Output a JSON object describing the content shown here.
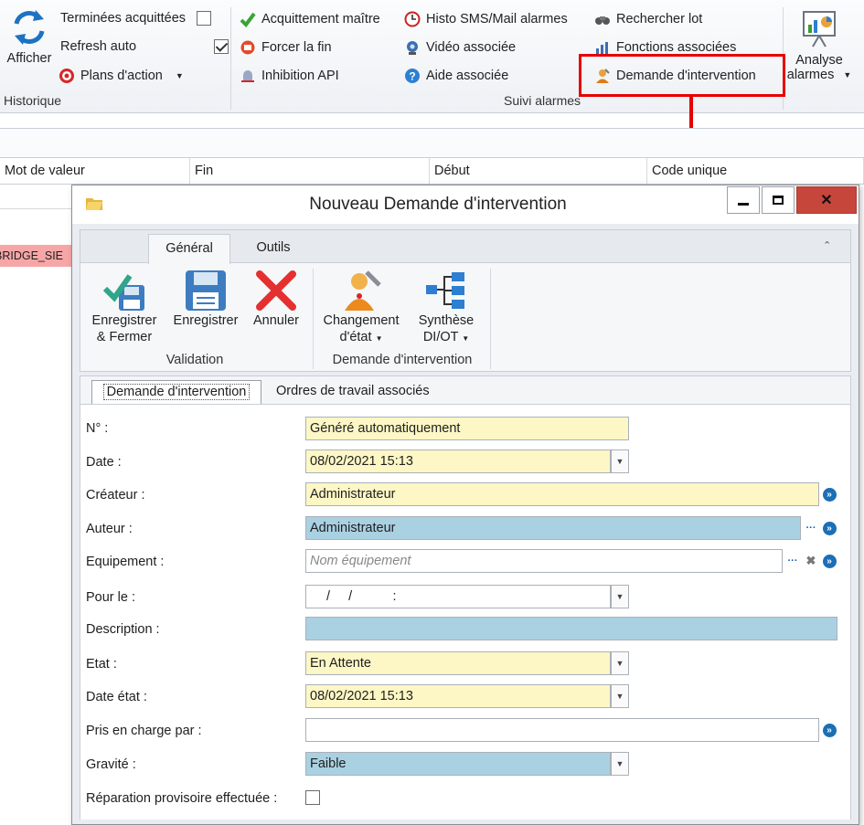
{
  "ribbon": {
    "afficher": "Afficher",
    "terminees": "Terminées acquittées",
    "refresh": "Refresh auto",
    "plans": "Plans d'action",
    "historique": "Historique",
    "acquittement": "Acquittement maître",
    "forcer": "Forcer la fin",
    "inhibition": "Inhibition API",
    "histo": "Histo SMS/Mail alarmes",
    "video": "Vidéo associée",
    "aide": "Aide associée",
    "rechercher": "Rechercher lot",
    "fonctions": "Fonctions associées",
    "demande": "Demande d'intervention",
    "suivi": "Suivi alarmes",
    "analyse": "Analyse",
    "alarmes": "alarmes"
  },
  "grid": {
    "columns": [
      "Mot de valeur",
      "Fin",
      "Début",
      "Code unique"
    ],
    "row_text": "BRIDGE_SIE"
  },
  "dialog": {
    "title": "Nouveau Demande d'intervention",
    "tabs": [
      "Général",
      "Outils"
    ],
    "buttons": {
      "save_close_1": "Enregistrer",
      "save_close_2": "& Fermer",
      "save": "Enregistrer",
      "cancel": "Annuler",
      "change_1": "Changement",
      "change_2": "d'état",
      "synth_1": "Synthèse",
      "synth_2": "DI/OT"
    },
    "groups": [
      "Validation",
      "Demande d'intervention"
    ],
    "form_tabs": [
      "Demande d'intervention",
      "Ordres de travail associés"
    ],
    "fields": {
      "numero_label": "N° :",
      "numero_value": "Généré automatiquement",
      "date_label": "Date :",
      "date_value": "08/02/2021 15:13",
      "createur_label": "Créateur :",
      "createur_value": "Administrateur",
      "auteur_label": "Auteur :",
      "auteur_value": "Administrateur",
      "equipement_label": "Equipement :",
      "equipement_placeholder": "Nom équipement",
      "pour_le_label": "Pour le :",
      "pour_le_value": "/     /           :",
      "description_label": "Description :",
      "etat_label": "Etat :",
      "etat_value": "En Attente",
      "date_etat_label": "Date état :",
      "date_etat_value": "08/02/2021 15:13",
      "pris_label": "Pris en charge par :",
      "gravite_label": "Gravité :",
      "gravite_value": "Faible",
      "reparation_label": "Réparation provisoire effectuée :"
    }
  },
  "colors": {
    "highlight": "#e60000",
    "yellow_field": "#fdf7c6",
    "blue_field": "#a9d1e2",
    "close_button": "#c7463c"
  }
}
